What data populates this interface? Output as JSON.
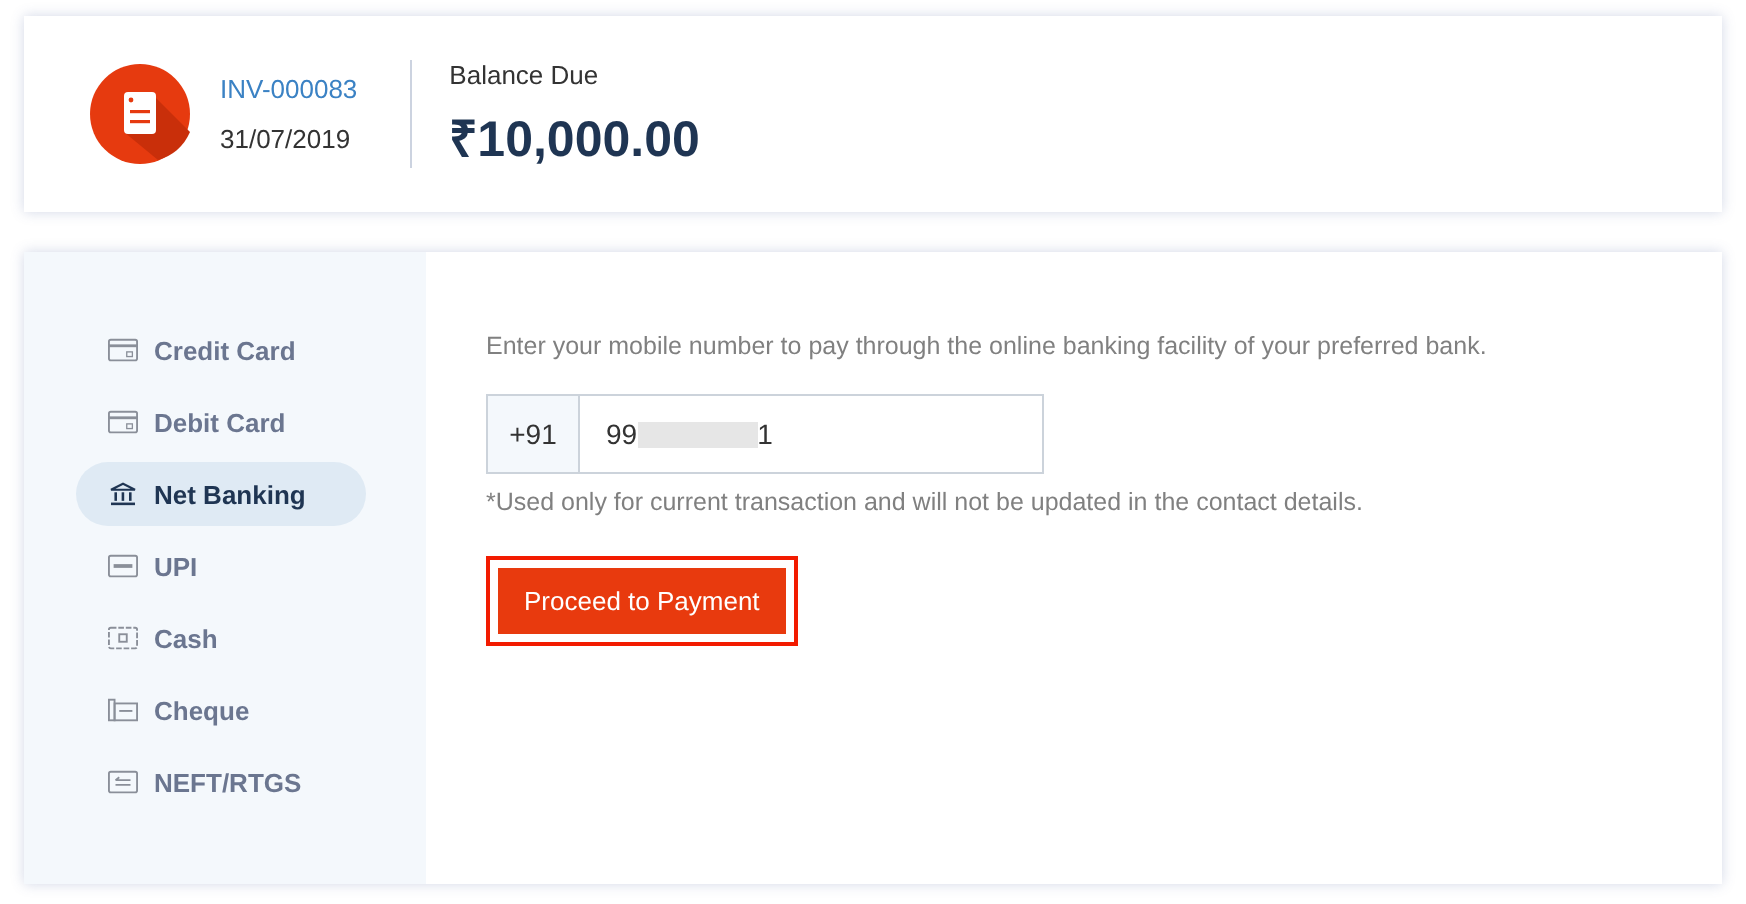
{
  "invoice": {
    "number": "INV-000083",
    "date": "31/07/2019",
    "balance_label": "Balance Due",
    "balance": "₹10,000.00"
  },
  "methods": [
    {
      "label": "Credit Card",
      "kind": "card",
      "selected": false
    },
    {
      "label": "Debit Card",
      "kind": "card",
      "selected": false
    },
    {
      "label": "Net Banking",
      "kind": "bank",
      "selected": true
    },
    {
      "label": "UPI",
      "kind": "upi",
      "selected": false
    },
    {
      "label": "Cash",
      "kind": "cash",
      "selected": false
    },
    {
      "label": "Cheque",
      "kind": "cheque",
      "selected": false
    },
    {
      "label": "NEFT/RTGS",
      "kind": "transfer",
      "selected": false
    }
  ],
  "form": {
    "instruction": "Enter your mobile number to pay through the online banking facility of your preferred bank.",
    "country_code": "+91",
    "phone_start": "99",
    "phone_end": "1",
    "redacted": true,
    "note": "*Used only for current transaction and will not be updated in the contact details.",
    "button": "Proceed to Payment",
    "button_highlighted": true
  }
}
